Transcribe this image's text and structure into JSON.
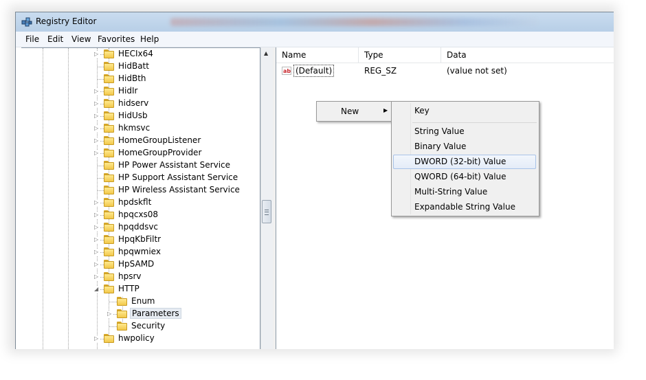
{
  "window": {
    "title": "Registry Editor"
  },
  "menu": [
    "File",
    "Edit",
    "View",
    "Favorites",
    "Help"
  ],
  "tree": {
    "items": [
      {
        "label": "HECIx64",
        "expandable": true
      },
      {
        "label": "HidBatt",
        "expandable": false
      },
      {
        "label": "HidBth",
        "expandable": false
      },
      {
        "label": "HidIr",
        "expandable": true
      },
      {
        "label": "hidserv",
        "expandable": true
      },
      {
        "label": "HidUsb",
        "expandable": true
      },
      {
        "label": "hkmsvc",
        "expandable": true
      },
      {
        "label": "HomeGroupListener",
        "expandable": true
      },
      {
        "label": "HomeGroupProvider",
        "expandable": true
      },
      {
        "label": "HP Power Assistant Service",
        "expandable": false
      },
      {
        "label": "HP Support Assistant Service",
        "expandable": false
      },
      {
        "label": "HP Wireless Assistant Service",
        "expandable": false
      },
      {
        "label": "hpdskflt",
        "expandable": true
      },
      {
        "label": "hpqcxs08",
        "expandable": true
      },
      {
        "label": "hpqddsvc",
        "expandable": true
      },
      {
        "label": "HpqKbFiltr",
        "expandable": true
      },
      {
        "label": "hpqwmiex",
        "expandable": true
      },
      {
        "label": "HpSAMD",
        "expandable": true
      },
      {
        "label": "hpsrv",
        "expandable": true
      },
      {
        "label": "HTTP",
        "expanded": true
      },
      {
        "label": "Enum",
        "child": true
      },
      {
        "label": "Parameters",
        "child": true,
        "selected": true,
        "expandable": true
      },
      {
        "label": "Security",
        "child": true
      },
      {
        "label": "hwpolicy",
        "expandable": true
      }
    ]
  },
  "list": {
    "columns": [
      "Name",
      "Type",
      "Data"
    ],
    "rows": [
      {
        "icon": "string-value-icon",
        "icon_text": "ab",
        "name": "(Default)",
        "type": "REG_SZ",
        "data": "(value not set)"
      }
    ]
  },
  "context_menu": {
    "new_label": "New",
    "submenu": [
      "Key",
      "String Value",
      "Binary Value",
      "DWORD (32-bit) Value",
      "QWORD (64-bit) Value",
      "Multi-String Value",
      "Expandable String Value"
    ],
    "highlighted": "DWORD (32-bit) Value"
  },
  "colors": {
    "titlebar": "#c9dcef",
    "highlight_border": "#a8c3e8",
    "folder": "#f2c84b"
  }
}
